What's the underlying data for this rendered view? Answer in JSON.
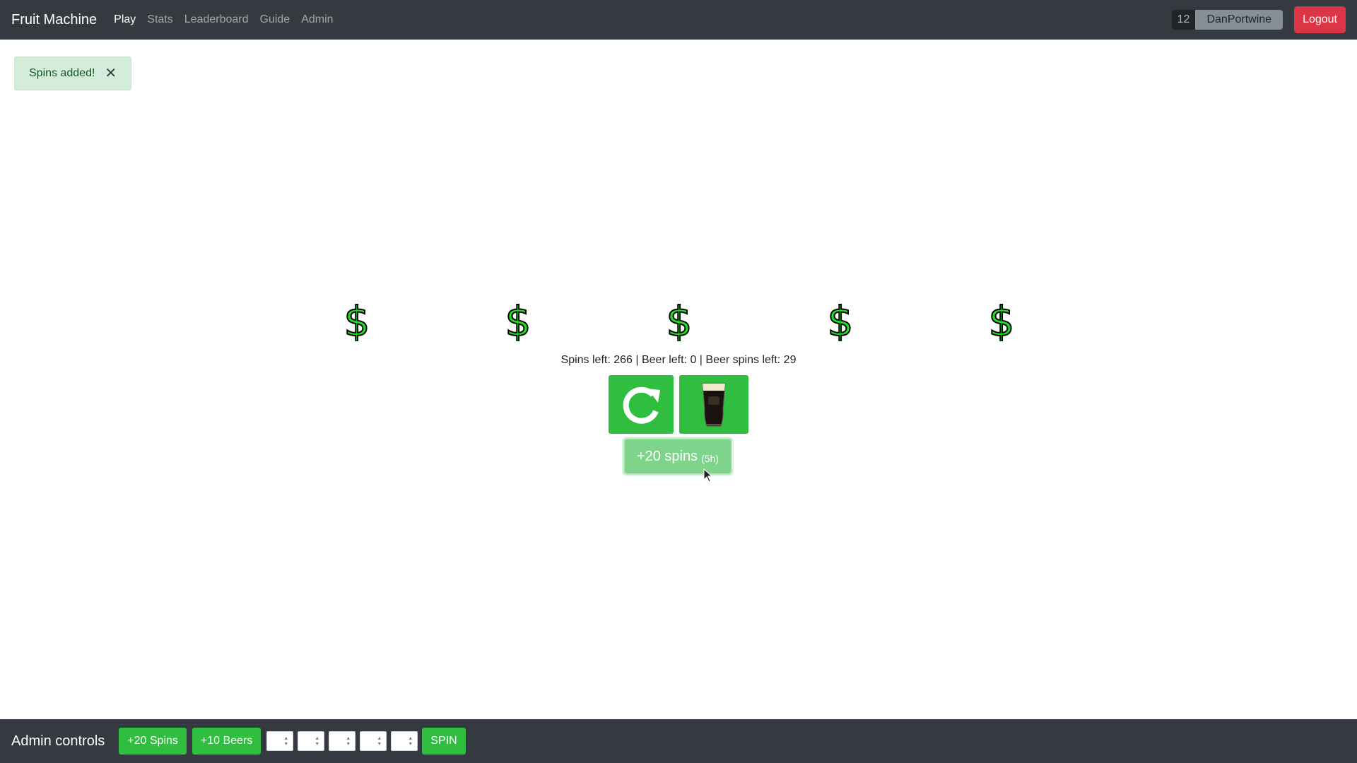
{
  "nav": {
    "brand": "Fruit Machine",
    "links": [
      {
        "label": "Play",
        "active": true
      },
      {
        "label": "Stats",
        "active": false
      },
      {
        "label": "Leaderboard",
        "active": false
      },
      {
        "label": "Guide",
        "active": false
      },
      {
        "label": "Admin",
        "active": false
      }
    ],
    "user_count": "12",
    "username": "DanPortwine",
    "logout_label": "Logout"
  },
  "alert": {
    "message": "Spins added!",
    "close_symbol": "✕"
  },
  "reels": [
    {
      "symbol": "dollar-icon"
    },
    {
      "symbol": "dollar-icon"
    },
    {
      "symbol": "dollar-icon"
    },
    {
      "symbol": "dollar-icon"
    },
    {
      "symbol": "dollar-icon"
    }
  ],
  "status": {
    "text": "Spins left: 266 | Beer left: 0 | Beer spins left: 29"
  },
  "controls": {
    "spin_icon": "refresh-icon",
    "beer_icon": "beer-glass-icon",
    "add_spins_label": "+20 spins",
    "add_spins_cooldown": "(5h)"
  },
  "admin": {
    "title": "Admin controls",
    "add_spins_label": "+20 Spins",
    "add_beers_label": "+10 Beers",
    "reel_inputs": [
      "",
      "",
      "",
      "",
      ""
    ],
    "spin_label": "SPIN"
  },
  "colors": {
    "navbar": "#343a40",
    "accent_green": "#2fbe3f",
    "logout_red": "#dc3545",
    "alert_bg": "#d4edda",
    "dollar_green": "#22dd22"
  }
}
